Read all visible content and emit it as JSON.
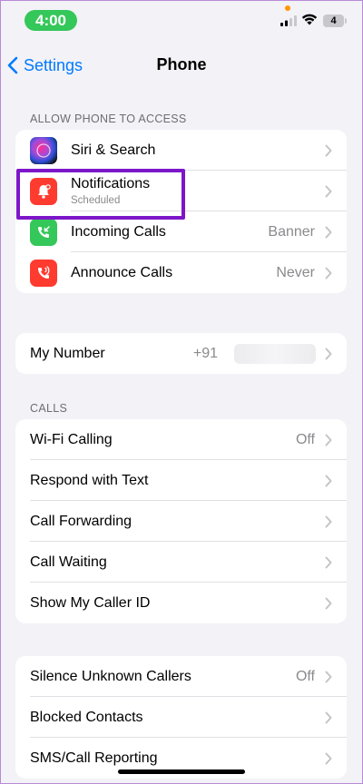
{
  "status_bar": {
    "time": "4:00",
    "battery": "4"
  },
  "nav": {
    "back_label": "Settings",
    "title": "Phone"
  },
  "section_access": {
    "header": "ALLOW PHONE TO ACCESS",
    "rows": [
      {
        "label": "Siri & Search",
        "value": ""
      },
      {
        "label": "Notifications",
        "sublabel": "Scheduled",
        "value": ""
      },
      {
        "label": "Incoming Calls",
        "value": "Banner"
      },
      {
        "label": "Announce Calls",
        "value": "Never"
      }
    ]
  },
  "my_number": {
    "label": "My Number",
    "value": "+91"
  },
  "section_calls": {
    "header": "CALLS",
    "rows": [
      {
        "label": "Wi-Fi Calling",
        "value": "Off"
      },
      {
        "label": "Respond with Text",
        "value": ""
      },
      {
        "label": "Call Forwarding",
        "value": ""
      },
      {
        "label": "Call Waiting",
        "value": ""
      },
      {
        "label": "Show My Caller ID",
        "value": ""
      }
    ]
  },
  "section_blocking": {
    "rows": [
      {
        "label": "Silence Unknown Callers",
        "value": "Off"
      },
      {
        "label": "Blocked Contacts",
        "value": ""
      },
      {
        "label": "SMS/Call Reporting",
        "value": ""
      }
    ]
  },
  "colors": {
    "accent": "#007aff",
    "highlight": "#7d16c9",
    "time_pill": "#34c759",
    "notifications_icon": "#ff3b30",
    "incoming_icon": "#34c759",
    "announce_icon": "#ff3b30"
  },
  "icons": {
    "siri": "siri-icon",
    "notifications": "notifications-icon",
    "incoming": "incoming-calls-icon",
    "announce": "announce-calls-icon"
  }
}
